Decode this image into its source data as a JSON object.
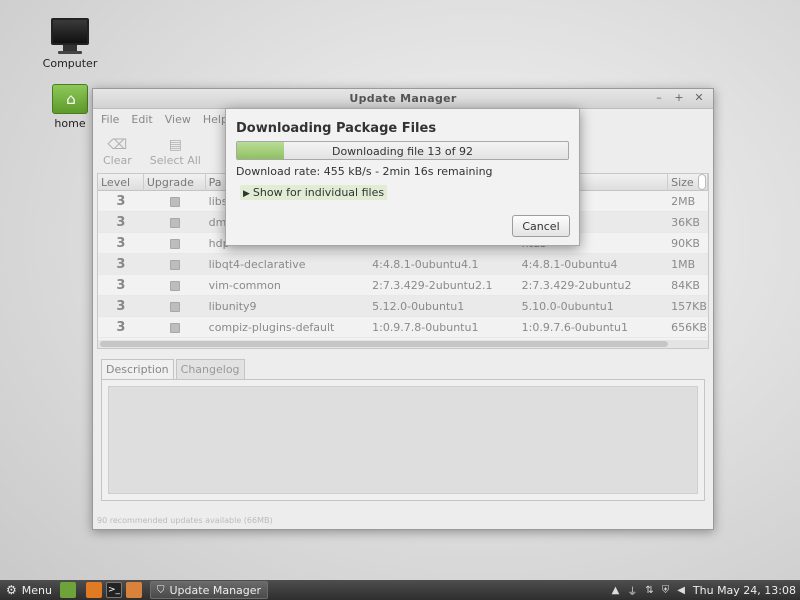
{
  "desktop": {
    "icons": [
      {
        "label": "Computer"
      },
      {
        "label": "home"
      }
    ]
  },
  "window": {
    "title": "Update Manager",
    "menu": [
      "File",
      "Edit",
      "View",
      "Help"
    ],
    "toolbar": {
      "clear_label": "Clear",
      "select_all_label": "Select All"
    },
    "table": {
      "headers": [
        "Level",
        "Upgrade",
        "Pa",
        "",
        "",
        "Size"
      ],
      "rows": [
        {
          "level": "3",
          "package": "libs",
          "old": "",
          "new": "ubuntu2",
          "size": "2MB"
        },
        {
          "level": "3",
          "package": "dmi",
          "old": "",
          "new": "ubuntu7",
          "size": "36KB"
        },
        {
          "level": "3",
          "package": "hdp",
          "old": "",
          "new": "ntu3",
          "size": "90KB"
        },
        {
          "level": "3",
          "package": "libqt4-declarative",
          "old": "4:4.8.1-0ubuntu4.1",
          "new": "4:4.8.1-0ubuntu4",
          "size": "1MB"
        },
        {
          "level": "3",
          "package": "vim-common",
          "old": "2:7.3.429-2ubuntu2.1",
          "new": "2:7.3.429-2ubuntu2",
          "size": "84KB"
        },
        {
          "level": "3",
          "package": "libunity9",
          "old": "5.12.0-0ubuntu1",
          "new": "5.10.0-0ubuntu1",
          "size": "157KB"
        },
        {
          "level": "3",
          "package": "compiz-plugins-default",
          "old": "1:0.9.7.8-0ubuntu1",
          "new": "1:0.9.7.6-0ubuntu1",
          "size": "656KB"
        }
      ]
    },
    "tabs": [
      "Description",
      "Changelog"
    ],
    "status": "90 recommended updates available (66MB)"
  },
  "dialog": {
    "title": "Downloading Package Files",
    "progress_text": "Downloading file 13 of 92",
    "progress_fraction": 0.1413,
    "rate": "Download rate: 455 kB/s - 2min 16s remaining",
    "expander_label": "Show for individual files",
    "cancel_label": "Cancel"
  },
  "taskbar": {
    "menu_label": "Menu",
    "task_label": "Update Manager",
    "clock": "Thu May 24, 13:08"
  },
  "colors": {
    "progress_fill": "#8fc162",
    "taskbar": "#3a3a3a"
  }
}
